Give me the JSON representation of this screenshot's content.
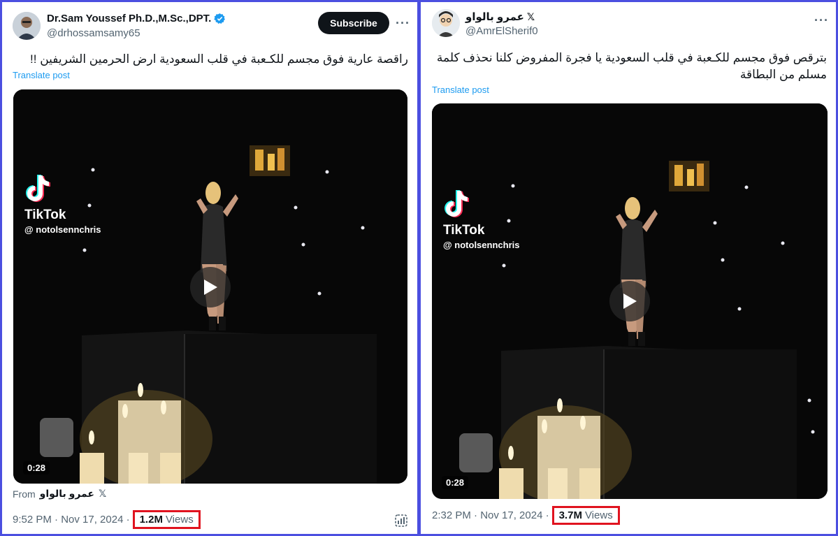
{
  "left_post": {
    "author_name": "Dr.Sam Youssef Ph.D.,M.Sc.,DPT.",
    "handle": "@drhossamsamy65",
    "subscribe_label": "Subscribe",
    "more_label": "···",
    "text": "راقصة عارية فوق مجسم للكـعبة في قلب السعودية ارض الحرمين الشريفين !!",
    "translate_label": "Translate post",
    "video": {
      "watermark_brand": "TikTok",
      "watermark_user": "@ notolsennchris",
      "duration": "0:28"
    },
    "from_label": "From",
    "from_name": "عمرو بالواو",
    "from_x": "𝕏",
    "time": "9:52 PM · Nov 17, 2024 ·",
    "views_count": "1.2M",
    "views_label": "Views"
  },
  "right_post": {
    "author_name": "عمرو بالواو",
    "author_x": "𝕏",
    "handle": "@AmrElSherif0",
    "more_label": "···",
    "text_line1": "بترقص فوق مجسم للكـعبة في قلب السعودية يا فجرة المفروض كلنا نحذف كلمة",
    "text_line2": "مسلم من البطاقة",
    "translate_label": "Translate post",
    "video": {
      "watermark_brand": "TikTok",
      "watermark_user": "@ notolsennchris",
      "duration": "0:28"
    },
    "time": "2:32 PM · Nov 17, 2024 ·",
    "views_count": "3.7M",
    "views_label": "Views"
  },
  "colors": {
    "frame": "#4b4fe0",
    "highlight_box": "#e0131f",
    "link": "#1d9bf0",
    "verified": "#1d9bf0"
  },
  "icons": [
    "verified-badge-icon",
    "x-logo-icon",
    "more-icon",
    "play-icon",
    "tiktok-logo-icon",
    "analytics-icon"
  ]
}
